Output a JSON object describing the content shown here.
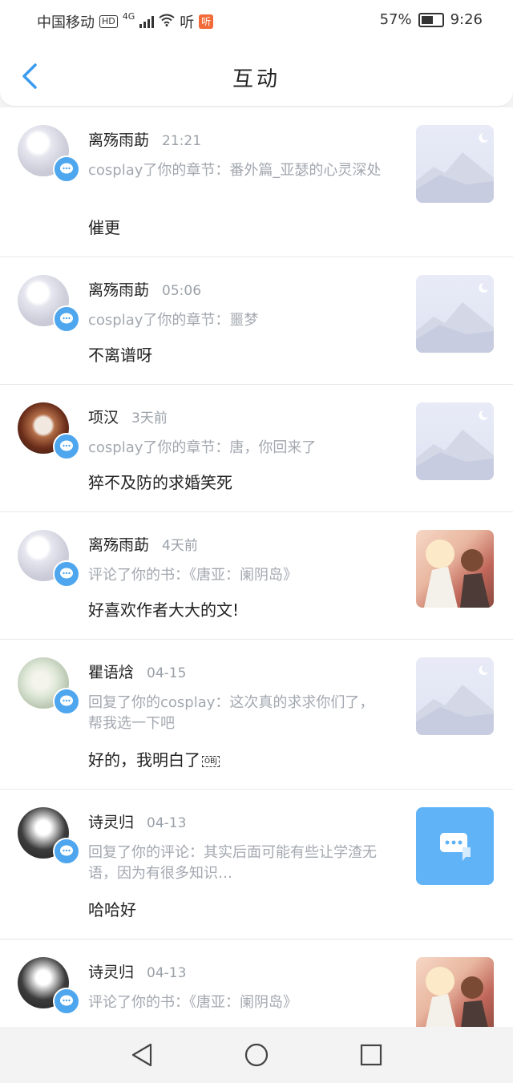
{
  "status_bar": {
    "carrier": "中国移动",
    "hd_label": "HD",
    "network": "4G",
    "ting_text": "听",
    "ting_badge": "听",
    "battery": "57%",
    "time": "9:26"
  },
  "header": {
    "title": "互动"
  },
  "items": [
    {
      "user": "离殇雨莇",
      "time": "21:21",
      "description": "cosplay了你的章节：番外篇_亚瑟的心灵深处",
      "content": "催更",
      "thumbnail": "placeholder"
    },
    {
      "user": "离殇雨莇",
      "time": "05:06",
      "description": "cosplay了你的章节：噩梦",
      "content": "不离谱呀",
      "thumbnail": "placeholder"
    },
    {
      "user": "项汉",
      "time": "3天前",
      "description": "cosplay了你的章节：唐，你回来了",
      "content": "猝不及防的求婚笑死",
      "thumbnail": "placeholder"
    },
    {
      "user": "离殇雨莇",
      "time": "4天前",
      "description": "评论了你的书：《唐亚：阑阴岛》",
      "content": "好喜欢作者大大的文!",
      "thumbnail": "book-cover"
    },
    {
      "user": "瞿语焓",
      "time": "04-15",
      "description": "回复了你的cosplay：这次真的求求你们了，帮我选一下吧",
      "content": "好的，我明白了",
      "content_suffix": "OBJ",
      "thumbnail": "placeholder"
    },
    {
      "user": "诗灵归",
      "time": "04-13",
      "description": "回复了你的评论：其实后面可能有些让学渣无语，因为有很多知识…",
      "content": "哈哈好",
      "thumbnail": "chat-icon"
    },
    {
      "user": "诗灵归",
      "time": "04-13",
      "description": "评论了你的书：《唐亚：阑阴岛》",
      "content": "",
      "thumbnail": "book-cover"
    }
  ],
  "colors": {
    "accent": "#4ea6ee",
    "chat_tile": "#60b3f6"
  }
}
